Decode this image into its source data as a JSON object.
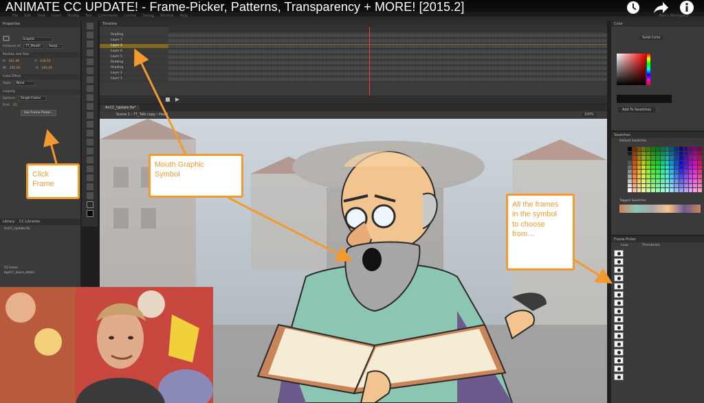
{
  "video": {
    "title": "ANIMATE CC UPDATE! - Frame-Picker, Patterns, Transparency + MORE! [2015.2]",
    "icons": [
      "clock-icon",
      "share-icon",
      "info-icon"
    ]
  },
  "app": {
    "menu": [
      "File",
      "Edit",
      "View",
      "Insert",
      "Modify",
      "Text",
      "Commands",
      "Control",
      "Debug",
      "Window",
      "Help"
    ],
    "workspace": "Alex's Workspace"
  },
  "properties": {
    "tab": "Properties",
    "symbol_type": "Graphic",
    "instance_of_label": "Instance of:",
    "instance_of": "TT_Mouth",
    "swap_label": "Swap...",
    "position_section": "Position and Size",
    "x_label": "X:",
    "x": "341.90",
    "y_label": "Y:",
    "y": "430.55",
    "w_label": "W:",
    "w": "205.05",
    "h_label": "H:",
    "h": "185.05",
    "color_effect_section": "Color Effect",
    "style_label": "Style:",
    "style": "None",
    "looping_section": "Looping",
    "options_label": "Options:",
    "options": "Single Frame",
    "first_label": "First:",
    "first": "25",
    "edit_frame_picker": "Use Frame Picker..."
  },
  "library": {
    "tabs": [
      "Library",
      "CC Libraries"
    ],
    "file": "AnCC_Update.fla",
    "count": "55 Items",
    "items": [
      "bgd17_biomi_detail"
    ]
  },
  "timeline": {
    "tab": "Timeline",
    "layers": [
      "Reading",
      "Layer 7",
      "Layer 4",
      "Layer 6",
      "Layer 5",
      "Reading",
      "Reading",
      "Layer 2",
      "Layer 1"
    ],
    "selected_layer": 2
  },
  "stage": {
    "doc_tab": "AnCC_Update.fla*",
    "breadcrumbs": [
      "Scene 1",
      "TT_Talk copy",
      "Head"
    ],
    "zoom": "100%"
  },
  "right_panels": {
    "color_title": "Color",
    "color_type": "Solid Color",
    "add_to_swatches": "Add To Swatches",
    "swatches_title": "Swatches",
    "default_swatches": "Default Swatches",
    "tagged_swatches": "Tagged Swatches",
    "frame_picker_title": "Frame Picker",
    "loop_label": "Loop",
    "thumbnails_label": "Thumbnails"
  },
  "callouts": {
    "click_frame": "Click\nFrame",
    "mouth_graphic": "Mouth Graphic\nSymbol",
    "all_frames": "All the frames\nin the symbol\nto choose\nfrom…"
  },
  "colors": {
    "callout_orange": "#f29a2e",
    "selected_layer": "#7e6a1e",
    "playhead": "#ff3b30"
  }
}
